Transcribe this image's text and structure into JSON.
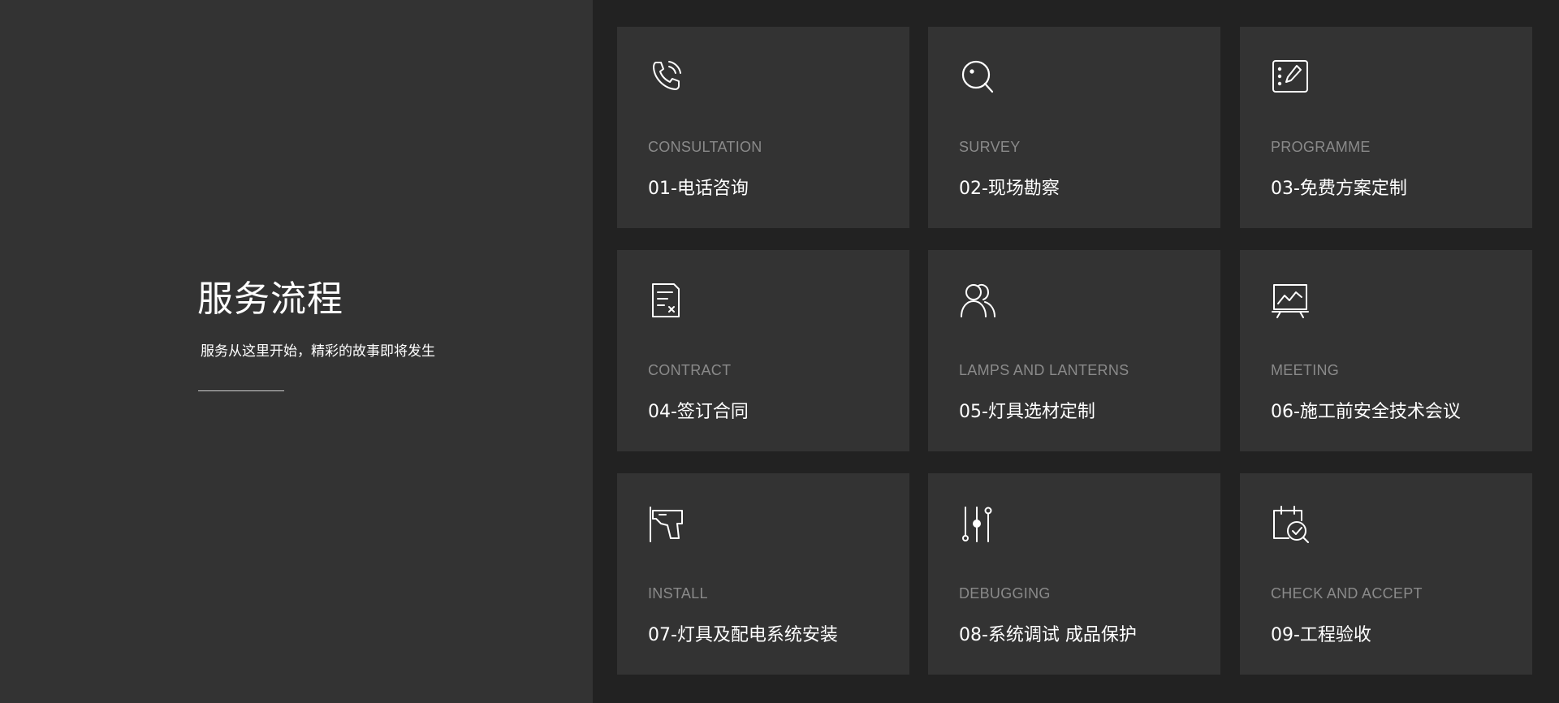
{
  "section": {
    "title": "服务流程",
    "subtitle": "服务从这里开始，精彩的故事即将发生"
  },
  "steps": [
    {
      "en": "CONSULTATION",
      "cn": "01-电话咨询",
      "icon": "phone-call-icon"
    },
    {
      "en": "SURVEY",
      "cn": "02-现场勘察",
      "icon": "search-icon"
    },
    {
      "en": "PROGRAMME",
      "cn": "03-免费方案定制",
      "icon": "edit-plan-icon"
    },
    {
      "en": "CONTRACT",
      "cn": "04-签订合同",
      "icon": "contract-icon"
    },
    {
      "en": "LAMPS AND LANTERNS",
      "cn": "05-灯具选材定制",
      "icon": "users-icon"
    },
    {
      "en": "MEETING",
      "cn": "06-施工前安全技术会议",
      "icon": "presentation-chart-icon"
    },
    {
      "en": "INSTALL",
      "cn": "07-灯具及配电系统安装",
      "icon": "drill-icon"
    },
    {
      "en": "DEBUGGING",
      "cn": "08-系统调试 成品保护",
      "icon": "sliders-icon"
    },
    {
      "en": "CHECK AND ACCEPT",
      "cn": "09-工程验收",
      "icon": "calendar-check-icon"
    }
  ],
  "colors": {
    "left_bg": "#333333",
    "grid_bg": "#222222",
    "card_bg": "#333333",
    "en_text": "#8a8a8a",
    "cn_text": "#ffffff"
  }
}
